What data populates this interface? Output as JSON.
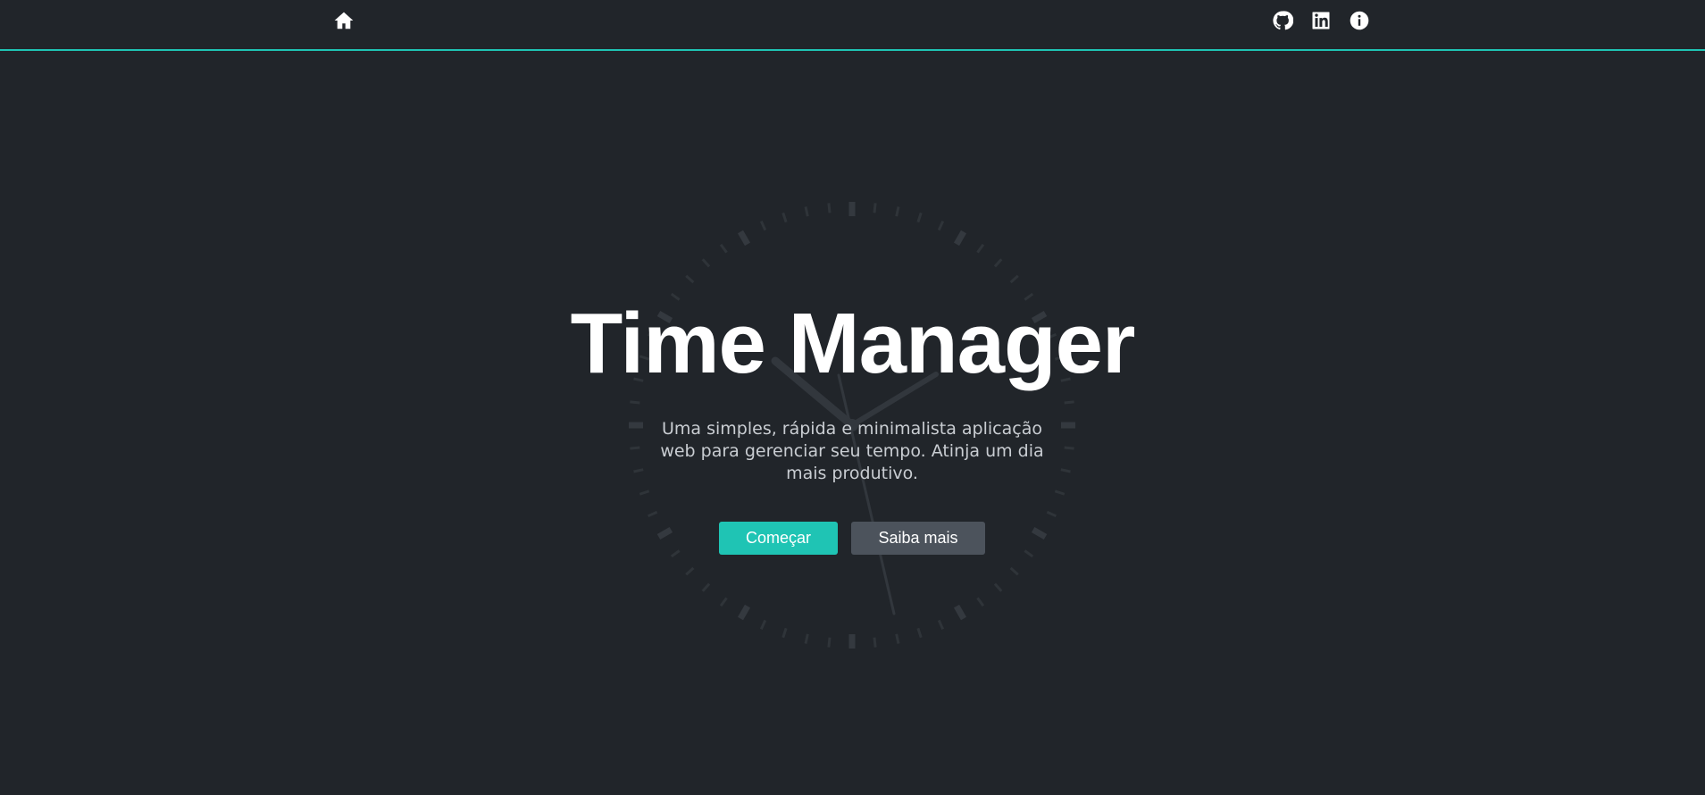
{
  "navbar": {
    "home_icon": "home-icon",
    "right_icons": [
      "github-icon",
      "linkedin-icon",
      "info-icon"
    ],
    "accent_color": "#1fc4b4"
  },
  "hero": {
    "title": "Time Manager",
    "subtitle": "Uma simples, rápida e minimalista aplicação web para gerenciar seu tempo. Atinja um dia mais produtivo.",
    "background_decoration": "clock-face"
  },
  "actions": {
    "start_label": "Começar",
    "more_label": "Saiba mais"
  },
  "colors": {
    "background": "#21252a",
    "primary_button": "#1fc4b4",
    "secondary_button": "#4c535c",
    "text": "#ffffff"
  }
}
